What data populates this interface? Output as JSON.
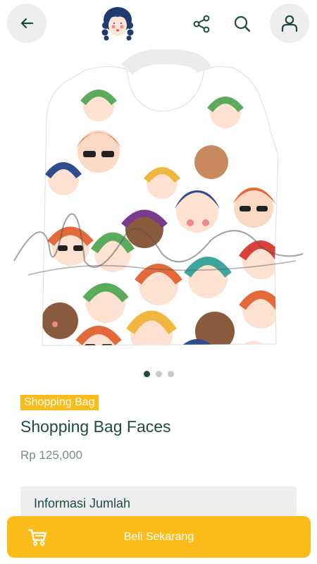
{
  "header": {
    "back_icon": "arrow-left-icon",
    "logo_icon": "girl-face-logo",
    "share_icon": "share-icon",
    "search_icon": "search-icon",
    "profile_icon": "user-icon"
  },
  "product": {
    "image_description_icon": "shopping-bag-faces-image",
    "carousel": {
      "count": 3,
      "active_index": 0
    },
    "category_badge": "Shopping Bag",
    "name": "Shopping Bag Faces",
    "price": "Rp 125,000"
  },
  "info_section": {
    "title": "Informasi Jumlah"
  },
  "buy_bar": {
    "cart_icon": "cart-icon",
    "label": "Beli Sekarang"
  },
  "colors": {
    "accent": "#fbbc1b",
    "primary_text": "#1f4a45",
    "muted_text": "#7a8a88",
    "button_bg": "#eeeeee"
  }
}
